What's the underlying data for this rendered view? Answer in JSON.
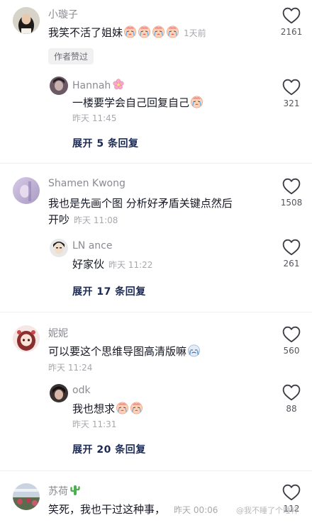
{
  "comments": [
    {
      "name": "小璇子",
      "text": "我笑不活了姐妹",
      "time": "1天前",
      "likes": "2161",
      "author_tag": "作者赞过",
      "reply": {
        "name": "Hannah",
        "text": "一楼要学会自己回复自己",
        "time": "昨天 11:45",
        "likes": "321"
      },
      "expand": "展开 5 条回复"
    },
    {
      "name": "Shamen Kwong",
      "text_line1": "我也是先画个图 分析好矛盾关键点然后",
      "text_line2": "开吵",
      "time": "昨天 11:08",
      "likes": "1508",
      "reply": {
        "name": "LN ance",
        "text": "好家伙",
        "time": "昨天 11:22",
        "likes": "261"
      },
      "expand": "展开 17 条回复"
    },
    {
      "name": "妮妮",
      "text": "可以要这个思维导图高清版嘛",
      "time": "昨天 11:24",
      "likes": "560",
      "reply": {
        "name": "odk",
        "text": "我也想求",
        "time": "昨天 11:31",
        "likes": "88"
      },
      "expand": "展开 20 条回复"
    },
    {
      "name": "苏荷",
      "text": "笑死，我也干过这种事，",
      "time": "昨天 00:06",
      "likes": "112"
    }
  ],
  "watermark": "@我不睡了个睡杯",
  "icons": {
    "like": "heart-outline-icon",
    "cry": "crying-face-emoji",
    "flower": "cherry-blossom-emoji",
    "cactus": "cactus-emoji"
  },
  "colors": {
    "accent_link": "#1b2a52",
    "muted": "#8a8b91"
  }
}
